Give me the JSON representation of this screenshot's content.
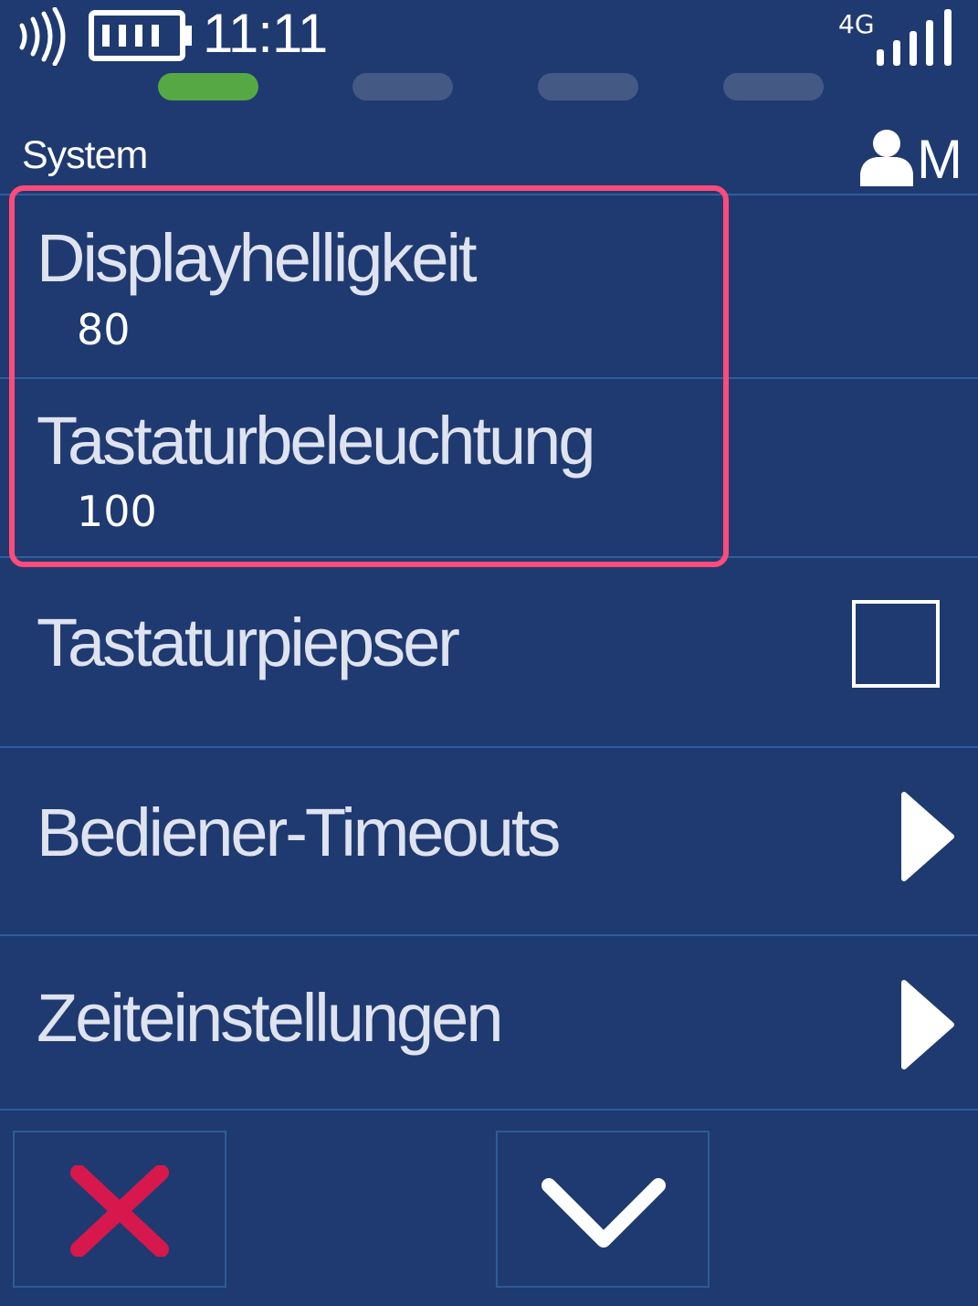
{
  "status_bar": {
    "time": "11:11",
    "network": "4G",
    "icons": [
      "nfc-icon",
      "battery-icon",
      "signal-strength-icon"
    ]
  },
  "page_indicator": {
    "count": 4,
    "active_index": 0,
    "active_color": "#56a844",
    "inactive_color": "#445a85"
  },
  "header": {
    "title": "System",
    "user_letter": "M",
    "user_icon": "user-icon"
  },
  "menu": {
    "items": [
      {
        "label": "Displayhelligkeit",
        "value": "80"
      },
      {
        "label": "Tastaturbeleuchtung",
        "value": "100"
      },
      {
        "label": "Tastaturpiepser",
        "checked": false
      },
      {
        "label": "Bediener-Timeouts",
        "icon": "chevron-right-icon"
      },
      {
        "label": "Zeiteinstellungen",
        "icon": "chevron-right-icon"
      }
    ],
    "highlight_color": "#ff4b79"
  },
  "footer": {
    "cancel_icon": "close-icon",
    "cancel_color": "#d7184c",
    "confirm_icon": "chevron-down-icon"
  },
  "colors": {
    "background": "#1f3a70",
    "separator": "#2c5f9e",
    "text": "#dfe3ef"
  }
}
